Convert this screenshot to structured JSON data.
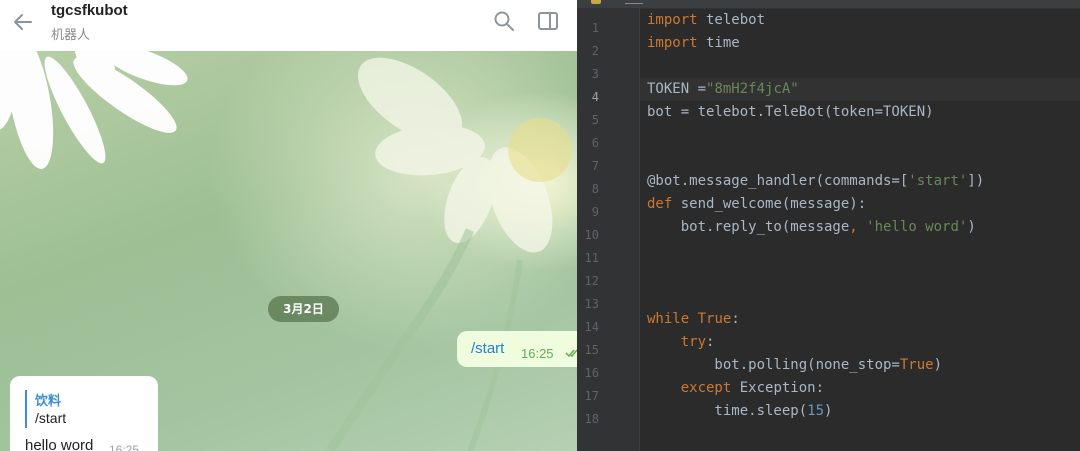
{
  "telegram": {
    "chat_title": "tgcsfkubot",
    "chat_subtitle": "机器人",
    "date_label": "3月2日",
    "outgoing": {
      "text": "/start",
      "time": "16:25"
    },
    "incoming": {
      "reply_author": "饮料",
      "reply_text": "/start",
      "text": "hello word",
      "time": "16:25"
    },
    "icons": [
      "back-arrow-icon",
      "search-icon",
      "side-panel-icon",
      "double-check-icon"
    ]
  },
  "editor": {
    "line_numbers": [
      "1",
      "2",
      "3",
      "4",
      "5",
      "6",
      "7",
      "8",
      "9",
      "10",
      "11",
      "12",
      "13",
      "14",
      "15",
      "16",
      "17",
      "18"
    ],
    "active_line": "4",
    "code": {
      "l1": {
        "kw": "import",
        "rest": " telebot"
      },
      "l2": {
        "kw": "import",
        "rest": " time"
      },
      "l4": {
        "a": "TOKEN =",
        "str": "\"8mH2f4jcA\""
      },
      "l5": {
        "text": "bot = telebot.TeleBot(token=TOKEN)"
      },
      "l8": {
        "a": "@bot.message_handler(commands=[",
        "str": "'start'",
        "b": "])"
      },
      "l9": {
        "kw": "def",
        "rest": " send_welcome(message):"
      },
      "l10": {
        "a": "    bot.reply_to(message",
        "comma": ",",
        "sp": " ",
        "str": "'hello word'",
        "b": ")"
      },
      "l14": {
        "kw": "while",
        "sp": " ",
        "kw2": "True",
        "b": ":"
      },
      "l15": {
        "ind": "    ",
        "kw": "try",
        "b": ":"
      },
      "l16": {
        "a": "        bot.polling(none_stop=",
        "kw": "True",
        "b": ")"
      },
      "l17": {
        "ind": "    ",
        "kw": "except",
        "b": " Exception:"
      },
      "l18": {
        "a": "        time.sleep(",
        "num": "15",
        "b": ")"
      }
    },
    "colors": {
      "keyword": "#cc7832",
      "string": "#6a8759",
      "number": "#6897bb",
      "text": "#a9b7c6",
      "background": "#2b2b2b"
    }
  }
}
